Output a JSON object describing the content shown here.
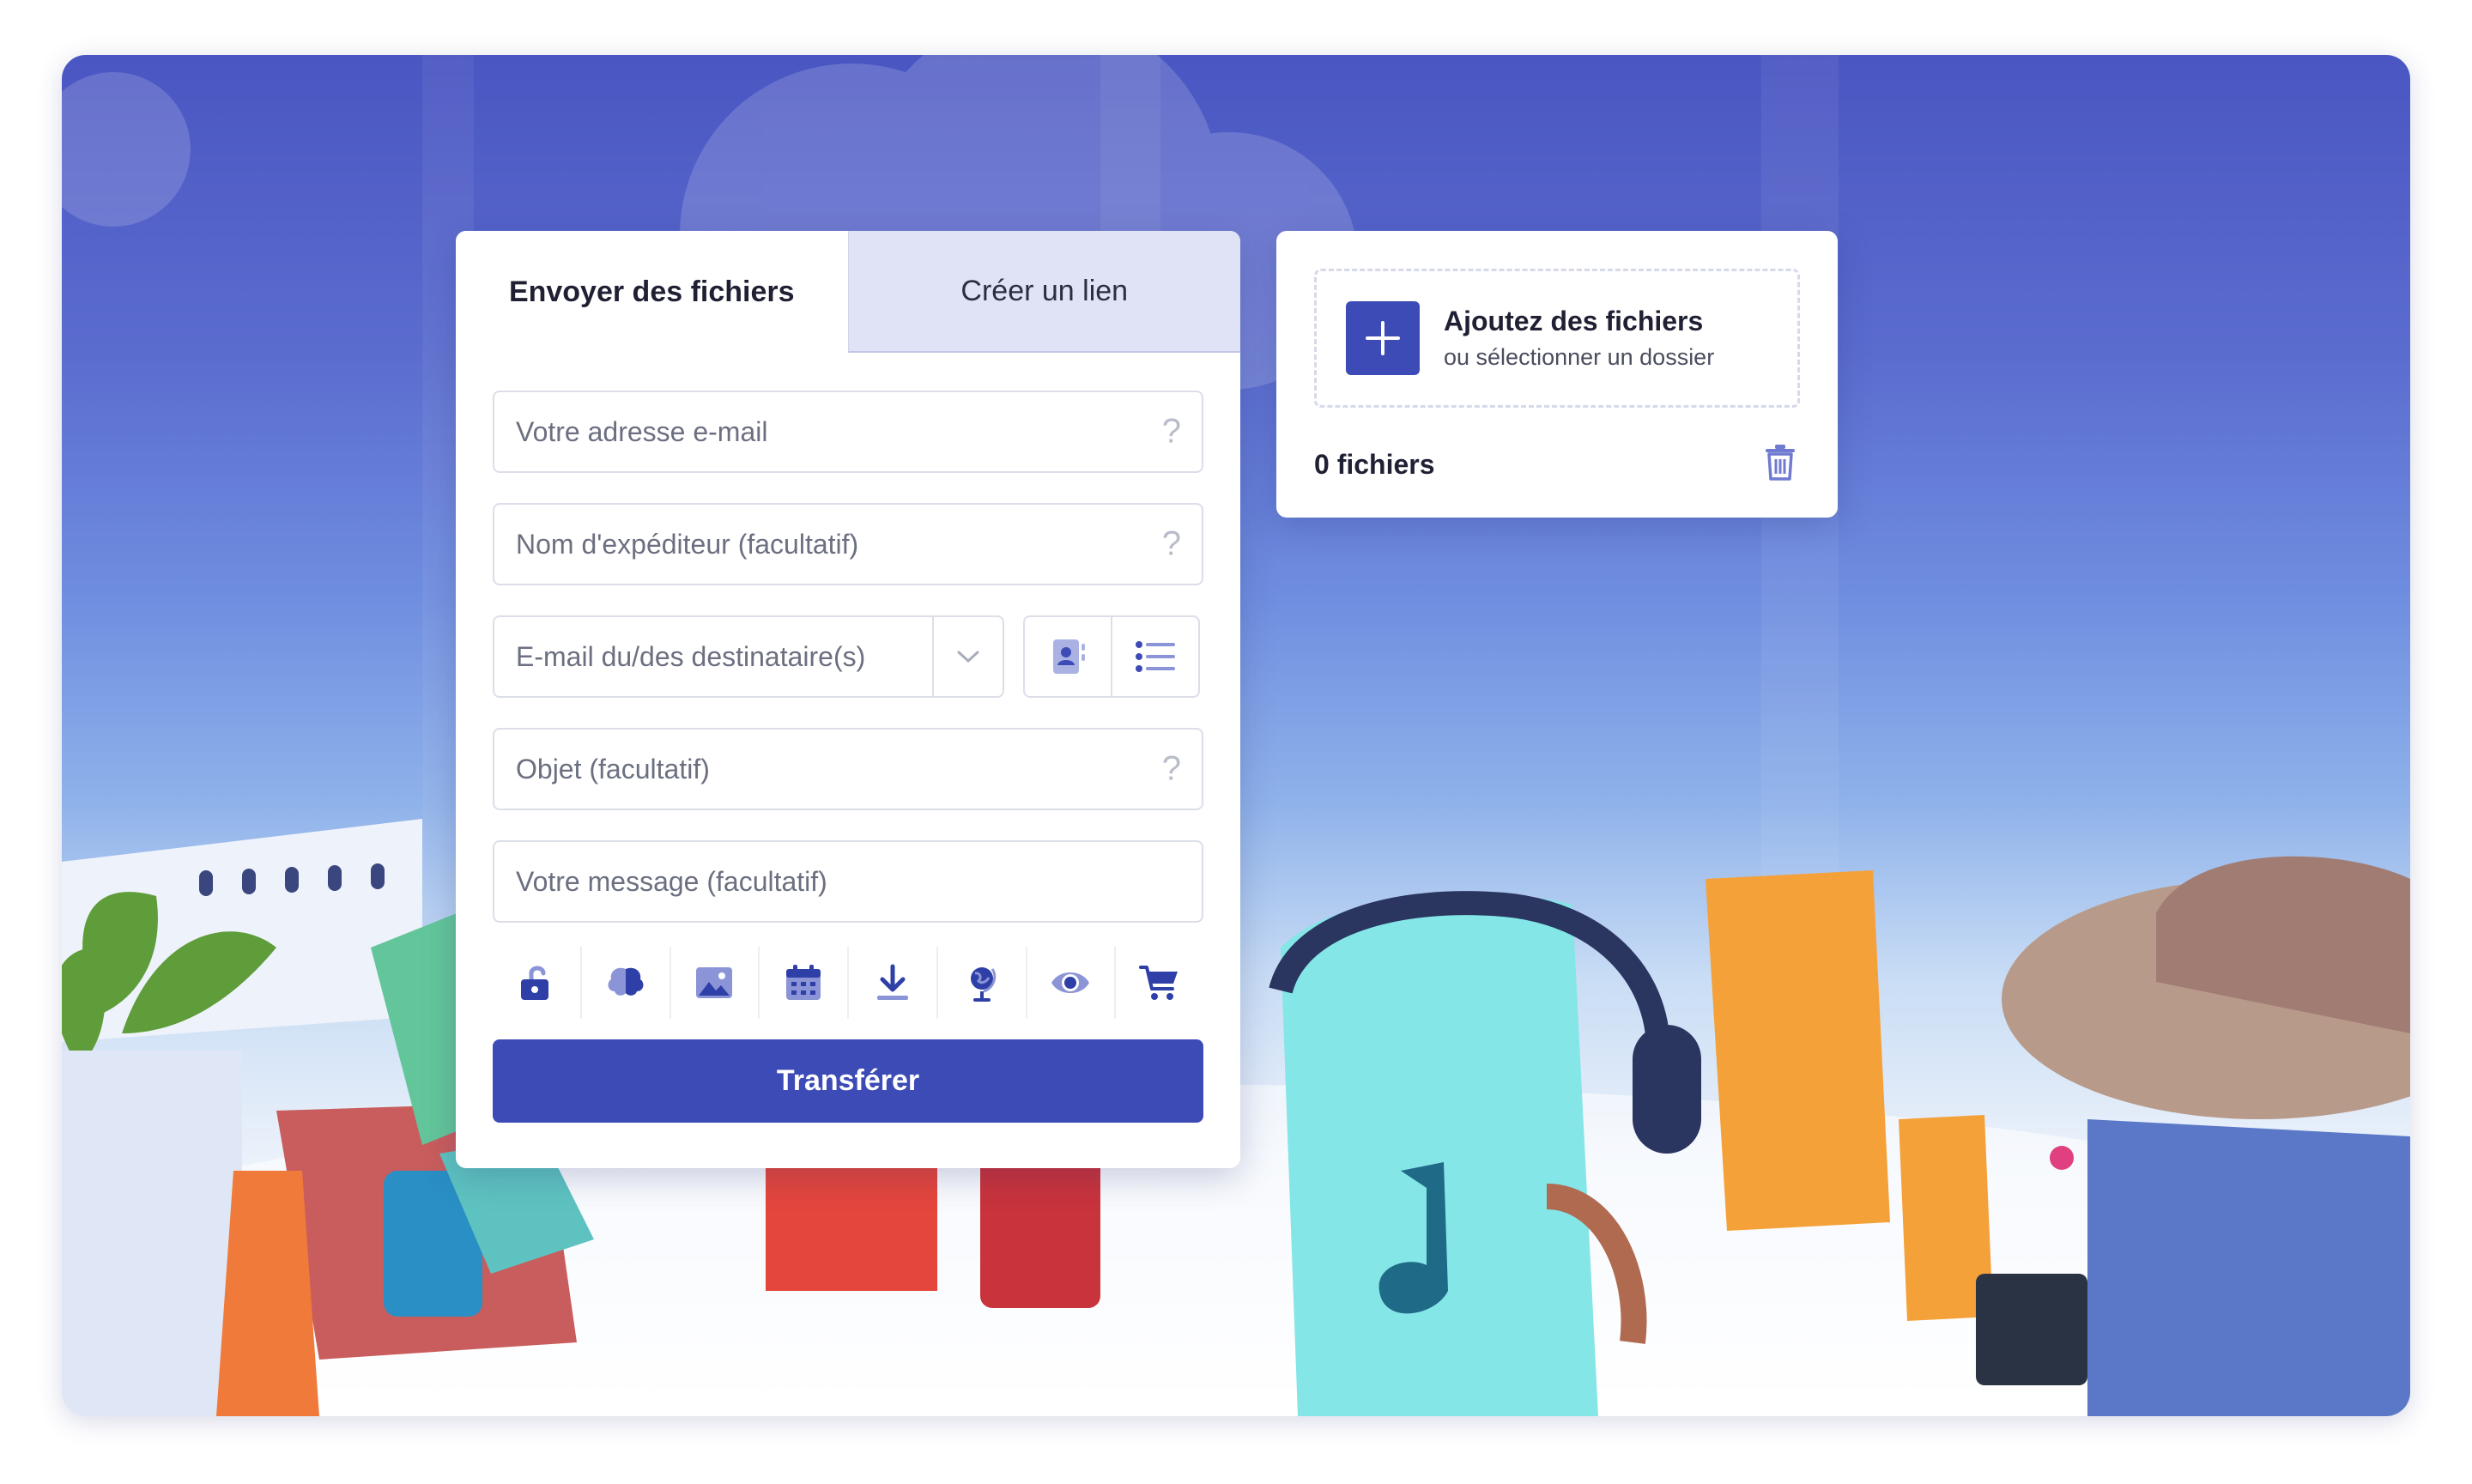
{
  "tabs": {
    "send": "Envoyer des fichiers",
    "link": "Créer un lien"
  },
  "form": {
    "email_placeholder": "Votre adresse e-mail",
    "sender_placeholder": "Nom d'expéditeur (facultatif)",
    "recipients_placeholder": "E-mail du/des destinataire(s)",
    "subject_placeholder": "Objet (facultatif)",
    "message_placeholder": "Votre message (facultatif)",
    "help_glyph": "?",
    "submit_label": "Transférer"
  },
  "options": [
    {
      "icon": "lock-icon"
    },
    {
      "icon": "brain-icon"
    },
    {
      "icon": "image-icon"
    },
    {
      "icon": "calendar-icon"
    },
    {
      "icon": "download-icon"
    },
    {
      "icon": "globe-icon"
    },
    {
      "icon": "eye-icon"
    },
    {
      "icon": "cart-icon"
    }
  ],
  "files": {
    "add_title": "Ajoutez des fichiers",
    "add_subtitle": "ou sélectionner un dossier",
    "count_label": "0 fichiers"
  },
  "colors": {
    "accent": "#3c4bb5",
    "icon_blue": "#2f3fa8",
    "bg_top": "#4a56c2"
  }
}
